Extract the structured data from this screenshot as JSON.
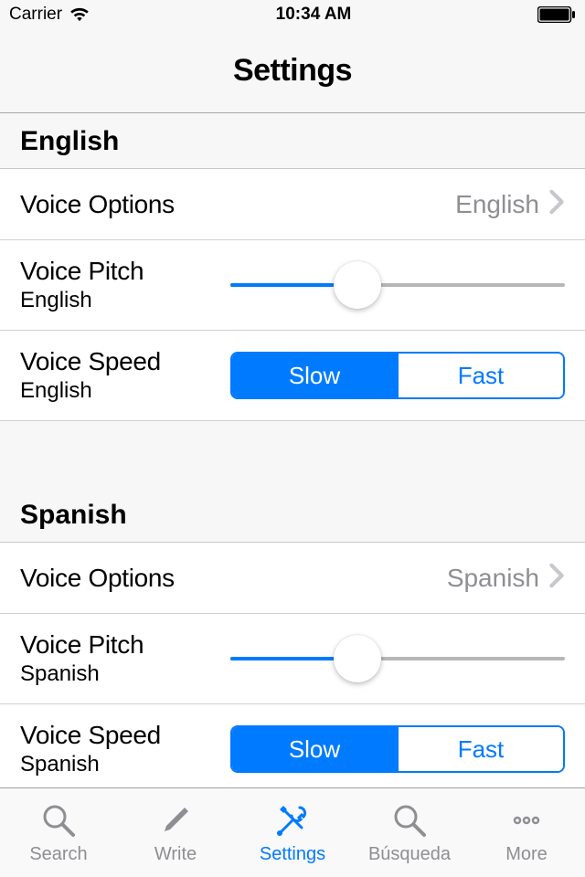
{
  "status": {
    "carrier": "Carrier",
    "time": "10:34 AM"
  },
  "nav": {
    "title": "Settings"
  },
  "sections": {
    "english": {
      "header": "English",
      "voice_options": {
        "label": "Voice Options",
        "value": "English"
      },
      "voice_pitch": {
        "label": "Voice Pitch",
        "sub": "English",
        "percent": 38
      },
      "voice_speed": {
        "label": "Voice Speed",
        "sub": "English",
        "slow": "Slow",
        "fast": "Fast",
        "selected": "slow"
      }
    },
    "spanish": {
      "header": "Spanish",
      "voice_options": {
        "label": "Voice Options",
        "value": "Spanish"
      },
      "voice_pitch": {
        "label": "Voice Pitch",
        "sub": "Spanish",
        "percent": 38
      },
      "voice_speed": {
        "label": "Voice Speed",
        "sub": "Spanish",
        "slow": "Slow",
        "fast": "Fast",
        "selected": "slow"
      }
    }
  },
  "tabs": {
    "search": "Search",
    "write": "Write",
    "settings": "Settings",
    "busqueda": "Búsqueda",
    "more": "More"
  }
}
